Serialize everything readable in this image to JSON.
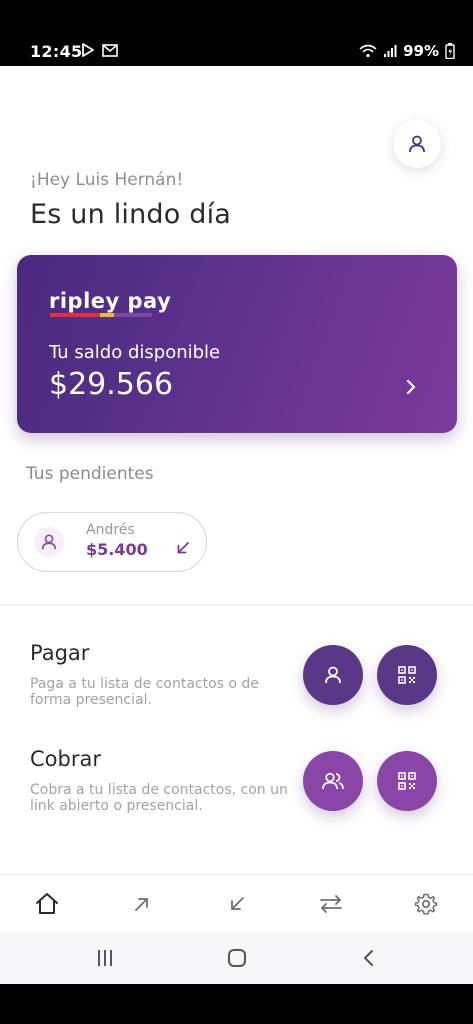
{
  "status_bar": {
    "time": "12:45",
    "battery": "99%",
    "icons": [
      "play-store-icon",
      "gmail-icon",
      "wifi-icon",
      "signal-icon",
      "battery-icon"
    ]
  },
  "header": {
    "greeting": "¡Hey Luis Hernán!",
    "headline": "Es un lindo día",
    "profile_icon": "user-icon"
  },
  "balance_card": {
    "brand": "ripley pay",
    "label": "Tu saldo disponible",
    "amount": "$29.566",
    "chevron_icon": "chevron-right-icon"
  },
  "pending": {
    "title": "Tus pendientes",
    "items": [
      {
        "name": "Andrés",
        "amount": "$5.400",
        "icon": "arrow-down-left-icon"
      }
    ]
  },
  "actions": [
    {
      "title": "Pagar",
      "description": "Paga a tu lista de contactos o de forma presencial.",
      "buttons": [
        "user-icon",
        "qr-icon"
      ]
    },
    {
      "title": "Cobrar",
      "description": "Cobra a tu lista de contactos, con un link abierto o presencial.",
      "buttons": [
        "users-icon",
        "qr-icon"
      ]
    }
  ],
  "bottom_nav": [
    "home-icon",
    "arrow-up-right-icon",
    "arrow-down-left-icon",
    "transfer-icon",
    "settings-icon"
  ],
  "colors": {
    "brand_purple": "#5b3787",
    "accent_purple": "#8a46a6",
    "amount_purple": "#7a3d95",
    "brand_red": "#e0303c",
    "brand_yellow": "#f2b531",
    "brand_violet": "#7a4aa0"
  }
}
